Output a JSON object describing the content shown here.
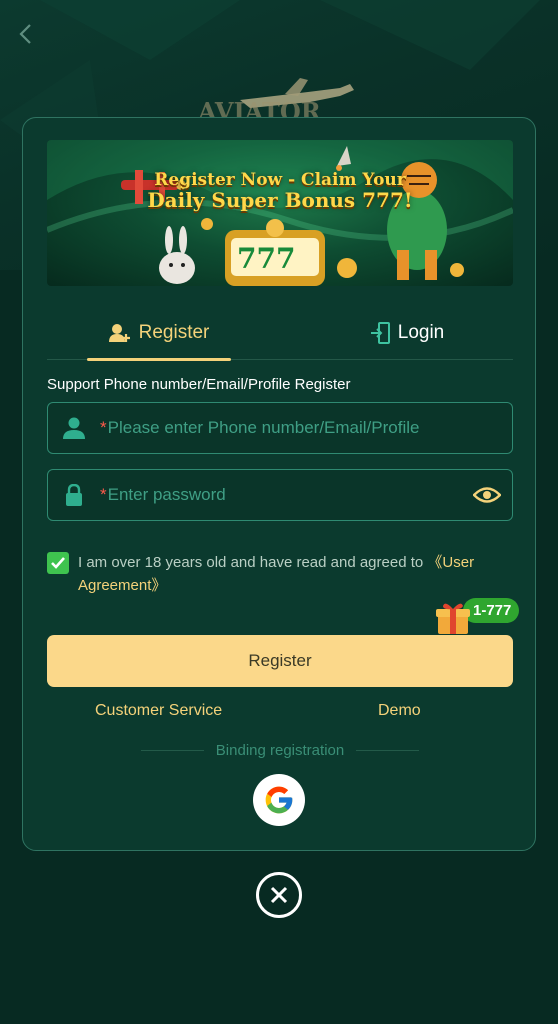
{
  "banner": {
    "headline_line1": "Register Now - Claim Your",
    "headline_line2": "Daily Super Bonus 777!",
    "slot_digits": "777"
  },
  "tabs": [
    {
      "label": "Register",
      "active": true,
      "icon": "user-add-icon"
    },
    {
      "label": "Login",
      "active": false,
      "icon": "login-door-icon"
    }
  ],
  "form": {
    "support_label": "Support Phone number/Email/Profile Register",
    "phone": {
      "placeholder": "Please enter Phone number/Email/Profile",
      "value": "",
      "required_mark": "*",
      "icon": "user-icon"
    },
    "password": {
      "placeholder": "Enter password",
      "value": "",
      "required_mark": "*",
      "icon": "lock-icon",
      "toggle_icon": "eye-icon"
    }
  },
  "agreement": {
    "checked": true,
    "text": "I am over 18 years old and have read and agreed to ",
    "link": "《User Agreement》"
  },
  "bonus_badge": {
    "label": "1-777",
    "icon": "gift-icon"
  },
  "register_button": "Register",
  "links": {
    "customer_service": "Customer Service",
    "demo": "Demo"
  },
  "binding_label": "Binding registration",
  "social": [
    {
      "name": "google",
      "icon": "google-icon"
    }
  ],
  "colors": {
    "background": "#072a22",
    "modal": "#0b3a2e",
    "accent_gold": "#f4d27a",
    "button": "#fbd88a",
    "field_border": "#2f8a72",
    "check_green": "#3fc34f"
  }
}
